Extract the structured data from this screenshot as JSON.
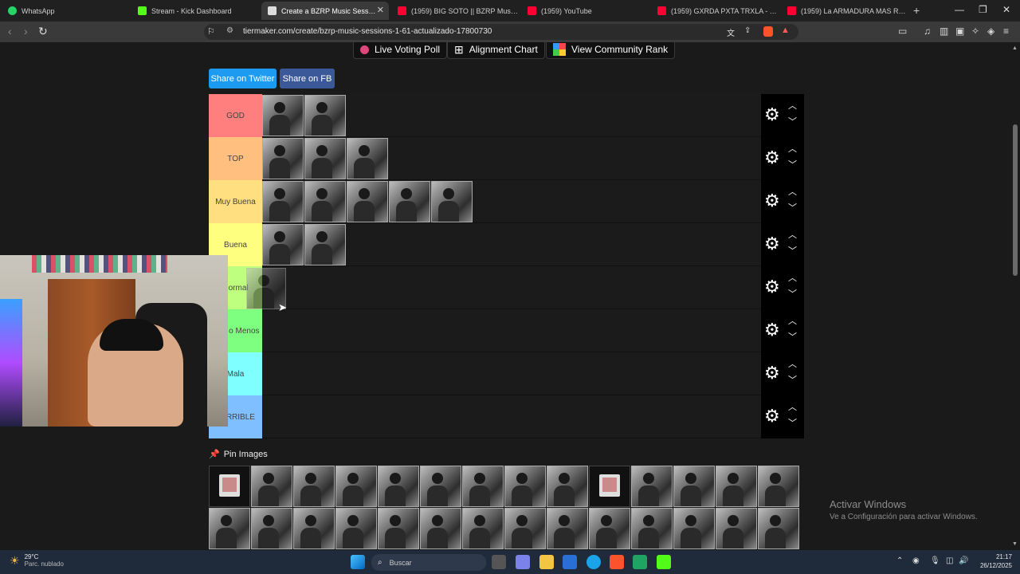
{
  "browser": {
    "tabs": [
      {
        "label": "WhatsApp",
        "color": "#25d366"
      },
      {
        "label": "Stream - Kick Dashboard",
        "color": "#53fc18"
      },
      {
        "label": "Create a BZRP Music Sessions 1",
        "color": "#555555",
        "active": true
      },
      {
        "label": "(1959) BIG SOTO || BZRP Music S",
        "color": "#ff0033"
      },
      {
        "label": "(1959) YouTube",
        "color": "#ff0033"
      },
      {
        "label": "(1959) GXRDA PXTA TRXLA - YouTub",
        "color": "#ff0033"
      },
      {
        "label": "(1959) La ARMADURA MAS RARA de",
        "color": "#ff0033"
      }
    ],
    "url": "tiermaker.com/create/bzrp-music-sessions-1-61-actualizado-17800730"
  },
  "page": {
    "top_buttons": {
      "live_voting": "Live Voting Poll",
      "alignment": "Alignment Chart",
      "community_rank": "View Community Rank"
    },
    "share": {
      "twitter": "Share on Twitter",
      "fb": "Share on FB",
      "twitter_color": "#1d9bf0",
      "fb_color": "#3b5998"
    },
    "tiers": [
      {
        "label": "GOD",
        "color": "#ff7f7f",
        "items": 2
      },
      {
        "label": "TOP",
        "color": "#ffbf7f",
        "items": 3
      },
      {
        "label": "Muy Buena",
        "color": "#ffdf7f",
        "items": 5
      },
      {
        "label": "Buena",
        "color": "#ffff7f",
        "items": 2
      },
      {
        "label": "Normal",
        "color": "#bfff7f",
        "items": 0
      },
      {
        "label": "Mas o Menos",
        "color": "#7fff7f",
        "items": 0
      },
      {
        "label": "Mala",
        "color": "#7fffff",
        "items": 0
      },
      {
        "label": "TERRIBLE",
        "color": "#7fbfff",
        "items": 0
      }
    ],
    "pin_images": "Pin Images",
    "pool_count": 28
  },
  "windows_watermark": {
    "title": "Activar Windows",
    "subtitle": "Ve a Configuración para activar Windows."
  },
  "taskbar": {
    "temp": "29°C",
    "weather": "Parc. nublado",
    "search_placeholder": "Buscar",
    "time": "21:17",
    "date": "26/12/2025"
  }
}
